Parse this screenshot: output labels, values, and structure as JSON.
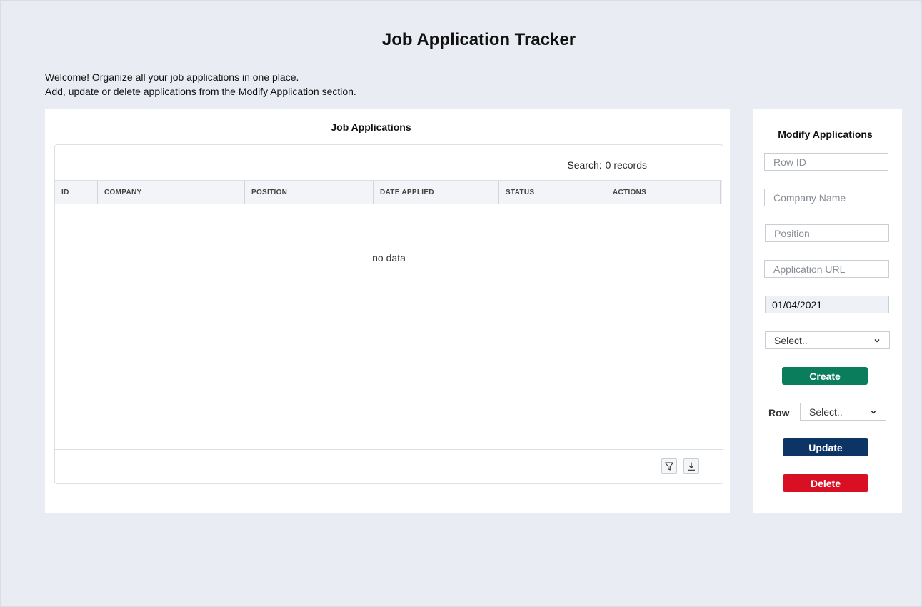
{
  "header": {
    "title": "Job Application Tracker",
    "intro_line1": "Welcome! Organize all your job applications in one place.",
    "intro_line2": "Add, update or delete applications from the Modify Application section."
  },
  "applications": {
    "title": "Job Applications",
    "search_label": "Search:",
    "records": "0 records",
    "columns": [
      "ID",
      "COMPANY",
      "POSITION",
      "DATE APPLIED",
      "STATUS",
      "ACTIONS"
    ],
    "rows": [],
    "empty_text": "no data",
    "footer_icons": [
      "filter-icon",
      "download-icon"
    ]
  },
  "modify": {
    "title": "Modify Applications",
    "row_id_placeholder": "Row ID",
    "company_placeholder": "Company Name",
    "position_placeholder": "Position",
    "url_placeholder": "Application URL",
    "date_value": "01/04/2021",
    "status_select": "Select..",
    "create_label": "Create",
    "row_label": "Row",
    "row_select": "Select..",
    "update_label": "Update",
    "delete_label": "Delete"
  },
  "colors": {
    "background": "#e9ecf3",
    "create": "#0a7d5c",
    "update": "#0c3566",
    "delete": "#d90f24"
  }
}
